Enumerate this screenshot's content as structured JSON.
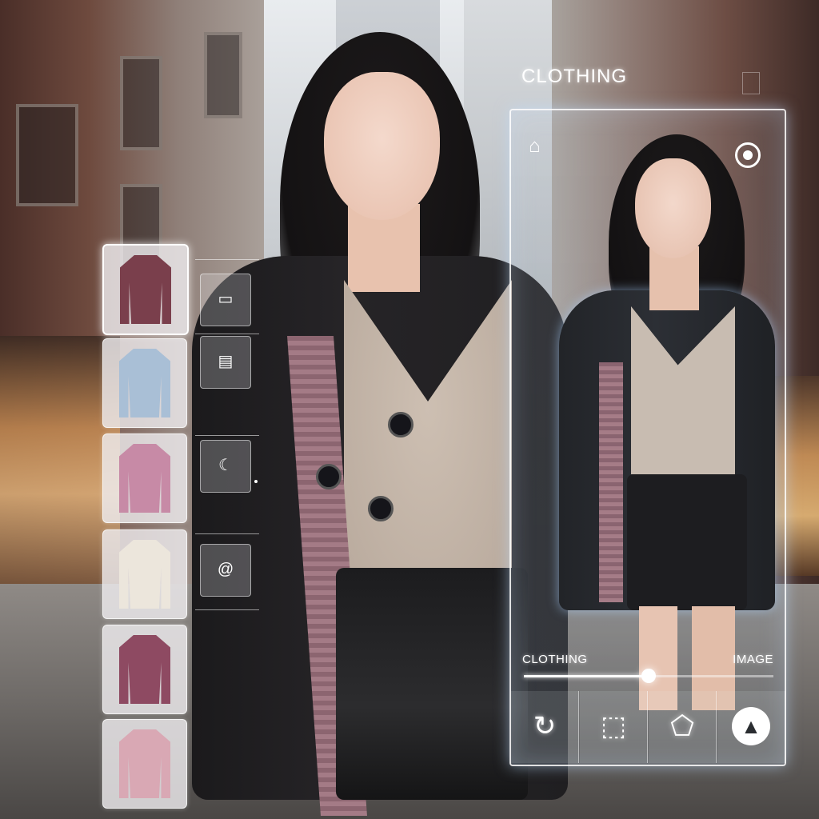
{
  "panel": {
    "title": "CLOTHING",
    "slider": {
      "left_label": "CLOTHING",
      "right_label": "IMAGE",
      "value_fraction": 0.5
    },
    "top_left_icon": "hanger-icon",
    "top_right_icon": "record-icon",
    "actions": [
      {
        "icon": "rotate-icon",
        "glyph": "↻"
      },
      {
        "icon": "cube-icon",
        "glyph": "⬚"
      },
      {
        "icon": "shape-icon",
        "glyph": "⬠"
      },
      {
        "icon": "triangle-icon",
        "glyph": "▲"
      }
    ]
  },
  "thumbnails": [
    {
      "name": "burgundy-blazer",
      "color": "#7a3f4c",
      "active": true
    },
    {
      "name": "light-blue-jacket",
      "color": "#a9bfd6",
      "active": false
    },
    {
      "name": "pink-knit-cardigan",
      "color": "#c78aa6",
      "active": false
    },
    {
      "name": "cream-sweater",
      "color": "#ece6dc",
      "active": false
    },
    {
      "name": "mauve-cardigan",
      "color": "#8e4a62",
      "active": false
    },
    {
      "name": "dusty-pink-top",
      "color": "#d9a8b4",
      "active": false
    }
  ],
  "tool_icons": [
    "image-icon",
    "layers-icon",
    "moon-icon",
    "swirl-icon"
  ],
  "colors": {
    "panel_glow": "#bcdcff",
    "accent_white": "#ffffff"
  }
}
